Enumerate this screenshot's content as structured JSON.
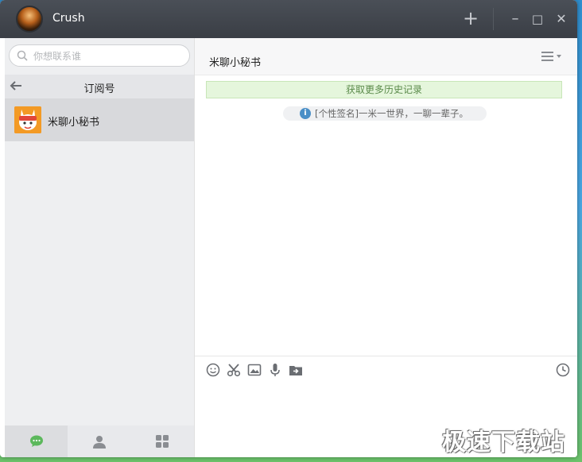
{
  "app": {
    "title": "Crush",
    "add_label": "+",
    "minimize_label": "–",
    "maximize_label": "□",
    "close_label": "✕"
  },
  "sidebar": {
    "search_placeholder": "你想联系谁",
    "section_title": "订阅号",
    "contacts": [
      {
        "name": "米聊小秘书"
      }
    ],
    "nav": [
      "chat-icon",
      "contacts-icon",
      "apps-icon"
    ]
  },
  "chat": {
    "title": "米聊小秘书",
    "history_link": "获取更多历史记录",
    "notice_icon": "i",
    "notice": "[个性签名]一米一世界，一聊一辈子。",
    "toolbar": [
      "emoji-icon",
      "scissors-icon",
      "image-icon",
      "microphone-icon",
      "send-file-icon",
      "history-clock-icon"
    ]
  },
  "watermark": "极速下载站",
  "colors": {
    "titlebar": "#3f434a",
    "sidebar": "#eeeff1",
    "accent_green": "#5cb85c",
    "history_bg": "#e5f6dc"
  }
}
